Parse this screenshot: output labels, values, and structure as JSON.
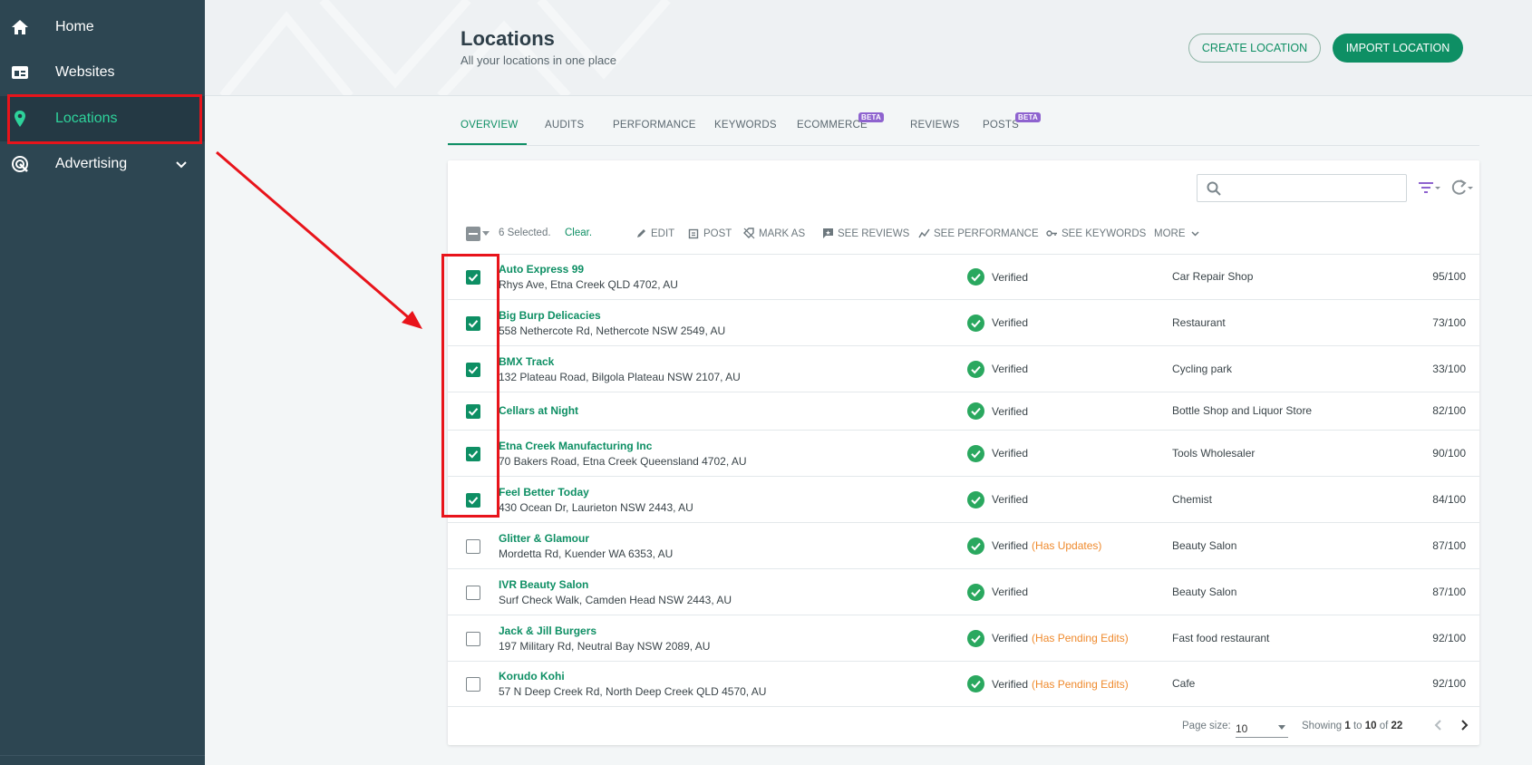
{
  "sidebar": {
    "items": [
      {
        "label": "Home",
        "icon": "home-icon"
      },
      {
        "label": "Websites",
        "icon": "website-icon"
      },
      {
        "label": "Locations",
        "icon": "location-pin-icon"
      },
      {
        "label": "Advertising",
        "icon": "target-icon"
      }
    ]
  },
  "header": {
    "title": "Locations",
    "subtitle": "All your locations in one place",
    "create_label": "CREATE LOCATION",
    "import_label": "IMPORT LOCATION"
  },
  "tabs": [
    {
      "label": "OVERVIEW",
      "beta": false
    },
    {
      "label": "AUDITS",
      "beta": false
    },
    {
      "label": "PERFORMANCE",
      "beta": false
    },
    {
      "label": "KEYWORDS",
      "beta": false
    },
    {
      "label": "ECOMMERCE",
      "beta": true
    },
    {
      "label": "REVIEWS",
      "beta": false
    },
    {
      "label": "POSTS",
      "beta": true
    }
  ],
  "beta_label": "BETA",
  "toolbar": {
    "selected_text": "6 Selected.",
    "clear_label": "Clear.",
    "edit_label": "EDIT",
    "post_label": "POST",
    "mark_as_label": "MARK AS",
    "see_reviews_label": "SEE REVIEWS",
    "see_performance_label": "SEE PERFORMANCE",
    "see_keywords_label": "SEE KEYWORDS",
    "more_label": "MORE"
  },
  "search": {
    "placeholder": ""
  },
  "rows": [
    {
      "checked": true,
      "name": "Auto Express 99",
      "address": "Rhys Ave, Etna Creek QLD 4702, AU",
      "status": "Verified",
      "note": "",
      "category": "Car Repair Shop",
      "score": "95/100"
    },
    {
      "checked": true,
      "name": "Big Burp Delicacies",
      "address": "558 Nethercote Rd, Nethercote NSW 2549, AU",
      "status": "Verified",
      "note": "",
      "category": "Restaurant",
      "score": "73/100"
    },
    {
      "checked": true,
      "name": "BMX Track",
      "address": "132 Plateau Road, Bilgola Plateau NSW 2107, AU",
      "status": "Verified",
      "note": "",
      "category": "Cycling park",
      "score": "33/100"
    },
    {
      "checked": true,
      "name": "Cellars at Night",
      "address": "",
      "status": "Verified",
      "note": "",
      "category": "Bottle Shop and Liquor Store",
      "score": "82/100"
    },
    {
      "checked": true,
      "name": "Etna Creek Manufacturing Inc",
      "address": "70 Bakers Road, Etna Creek Queensland 4702, AU",
      "status": "Verified",
      "note": "",
      "category": "Tools Wholesaler",
      "score": "90/100"
    },
    {
      "checked": true,
      "name": "Feel Better Today",
      "address": "430 Ocean Dr, Laurieton NSW 2443, AU",
      "status": "Verified",
      "note": "",
      "category": "Chemist",
      "score": "84/100"
    },
    {
      "checked": false,
      "name": "Glitter & Glamour",
      "address": "Mordetta Rd, Kuender WA 6353, AU",
      "status": "Verified",
      "note": "(Has Updates)",
      "category": "Beauty Salon",
      "score": "87/100"
    },
    {
      "checked": false,
      "name": "IVR Beauty Salon",
      "address": "Surf Check Walk, Camden Head NSW 2443, AU",
      "status": "Verified",
      "note": "",
      "category": "Beauty Salon",
      "score": "87/100"
    },
    {
      "checked": false,
      "name": "Jack & Jill Burgers",
      "address": "197 Military Rd, Neutral Bay NSW 2089, AU",
      "status": "Verified",
      "note": "(Has Pending Edits)",
      "category": "Fast food restaurant",
      "score": "92/100"
    },
    {
      "checked": false,
      "name": "Korudo Kohi",
      "address": "57 N Deep Creek Rd, North Deep Creek QLD 4570, AU",
      "status": "Verified",
      "note": "(Has Pending Edits)",
      "category": "Cafe",
      "score": "92/100"
    }
  ],
  "pager": {
    "page_size_label": "Page size:",
    "page_size_value": "10",
    "showing_prefix": "Showing",
    "from": "1",
    "to_word": "to",
    "to": "10",
    "of_word": "of",
    "total": "22"
  },
  "colors": {
    "accent": "#0e8f64",
    "sidebar": "#2d4652",
    "annotation": "#e8141b",
    "pending": "#ef8a2d",
    "beta": "#8e63cf"
  }
}
